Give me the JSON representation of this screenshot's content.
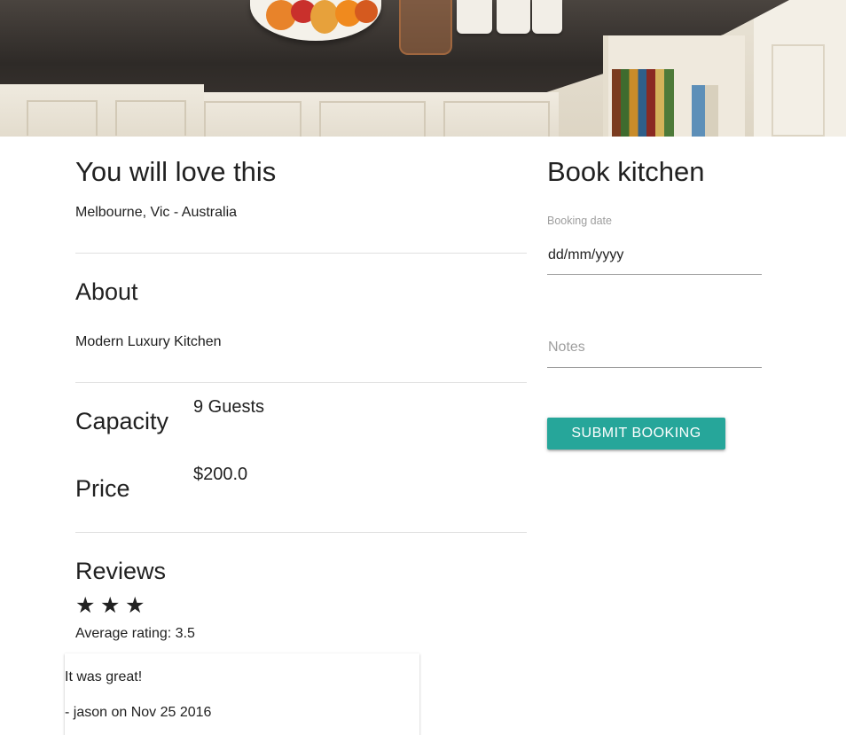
{
  "listing": {
    "title": "You will love this",
    "location": "Melbourne, Vic - Australia"
  },
  "about": {
    "heading": "About",
    "description": "Modern Luxury Kitchen"
  },
  "details": {
    "capacity_label": "Capacity",
    "capacity_value": "9 Guests",
    "price_label": "Price",
    "price_value": "$200.0"
  },
  "reviews": {
    "heading": "Reviews",
    "stars_shown": 3,
    "average_rating": "Average rating: 3.5",
    "items": [
      {
        "text": "It was great!",
        "meta": "- jason on Nov 25 2016"
      }
    ]
  },
  "booking": {
    "title": "Book kitchen",
    "date_label": "Booking date",
    "date_placeholder": "dd/mm/yyyy",
    "notes_placeholder": "Notes",
    "submit_label": "SUBMIT BOOKING"
  },
  "colors": {
    "accent": "#26a69a",
    "text": "#212121",
    "muted": "#9e9e9e",
    "divider": "#e0e0e0"
  },
  "icons": {
    "rating": "star-icon"
  }
}
